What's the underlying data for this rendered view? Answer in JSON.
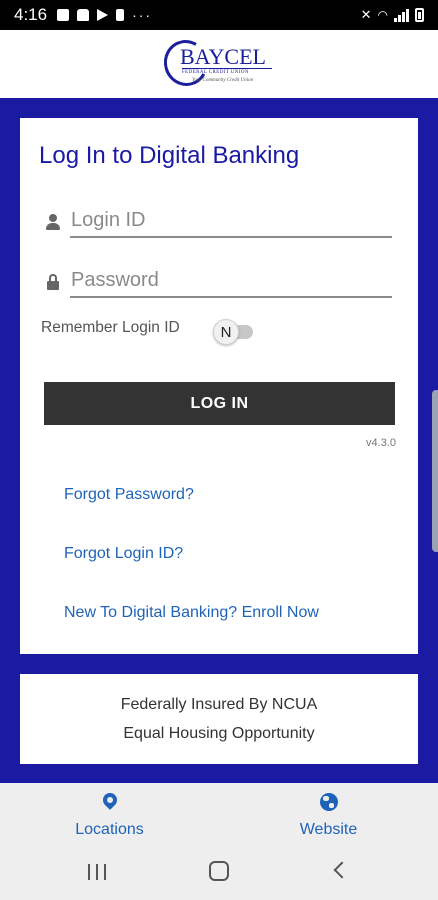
{
  "status_bar": {
    "time": "4:16",
    "left_icons": [
      "notification-icon",
      "bag-icon",
      "play-store-icon",
      "device-icon",
      "more-dots-icon"
    ],
    "right_icons": [
      "mute-icon",
      "wifi-icon",
      "signal-icon",
      "battery-icon"
    ],
    "more": "···"
  },
  "header": {
    "logo_name": "BAYCEL",
    "logo_sub": "FEDERAL CREDIT UNION",
    "logo_tagline": "Your Community Credit Union"
  },
  "login": {
    "title": "Log In to Digital Banking",
    "login_id_placeholder": "Login ID",
    "login_id_value": "",
    "password_placeholder": "Password",
    "password_value": "",
    "remember_label": "Remember Login ID",
    "remember_toggle_state": "N",
    "login_button": "LOG IN",
    "version": "v4.3.0",
    "forgot_password": "Forgot Password?",
    "forgot_login_id": "Forgot Login ID?",
    "enroll": "New To Digital Banking? Enroll Now"
  },
  "footer": {
    "line1": "Federally Insured By NCUA",
    "line2": "Equal Housing Opportunity"
  },
  "bottom_nav": {
    "items": [
      {
        "label": "Locations",
        "icon": "location-pin-icon"
      },
      {
        "label": "Website",
        "icon": "globe-icon"
      }
    ]
  },
  "colors": {
    "brand_blue": "#1a1aa3",
    "link_blue": "#1f63b8",
    "button_dark": "#333333"
  }
}
